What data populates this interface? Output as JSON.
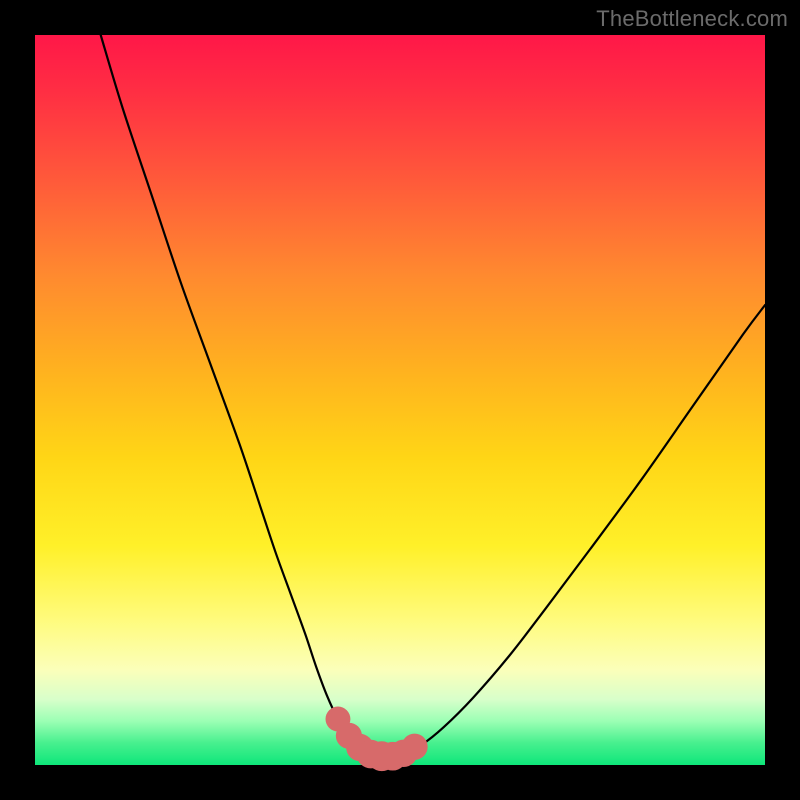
{
  "watermark": "TheBottleneck.com",
  "colors": {
    "page_bg": "#000000",
    "curve_stroke": "#000000",
    "marker_fill": "#d76a6a",
    "marker_stroke": "#c95a5a"
  },
  "chart_data": {
    "type": "line",
    "title": "",
    "xlabel": "",
    "ylabel": "",
    "xlim": [
      0,
      100
    ],
    "ylim": [
      0,
      100
    ],
    "grid": false,
    "legend": false,
    "series": [
      {
        "name": "bottleneck-curve",
        "x": [
          9,
          12,
          16,
          20,
          24,
          28,
          31,
          33,
          35,
          37,
          38.5,
          40,
          41.5,
          43,
          44.5,
          46,
          47.5,
          49,
          50.5,
          53,
          56,
          60,
          65,
          70,
          76,
          83,
          90,
          97,
          100
        ],
        "y": [
          100,
          90,
          78,
          66,
          55,
          44,
          35,
          29,
          23.5,
          18,
          13.5,
          9.5,
          6.3,
          4.0,
          2.4,
          1.5,
          1.2,
          1.2,
          1.6,
          2.8,
          5.2,
          9.2,
          15.0,
          21.5,
          29.5,
          39.0,
          49.0,
          59.0,
          63.0
        ]
      }
    ],
    "markers": {
      "name": "highlight-dots",
      "x": [
        41.5,
        43,
        44.5,
        46,
        47.5,
        49,
        50.5,
        52
      ],
      "y": [
        6.3,
        4.0,
        2.4,
        1.5,
        1.2,
        1.2,
        1.6,
        2.5
      ],
      "r": [
        1.2,
        1.3,
        1.4,
        1.5,
        1.6,
        1.5,
        1.4,
        1.3
      ]
    }
  }
}
